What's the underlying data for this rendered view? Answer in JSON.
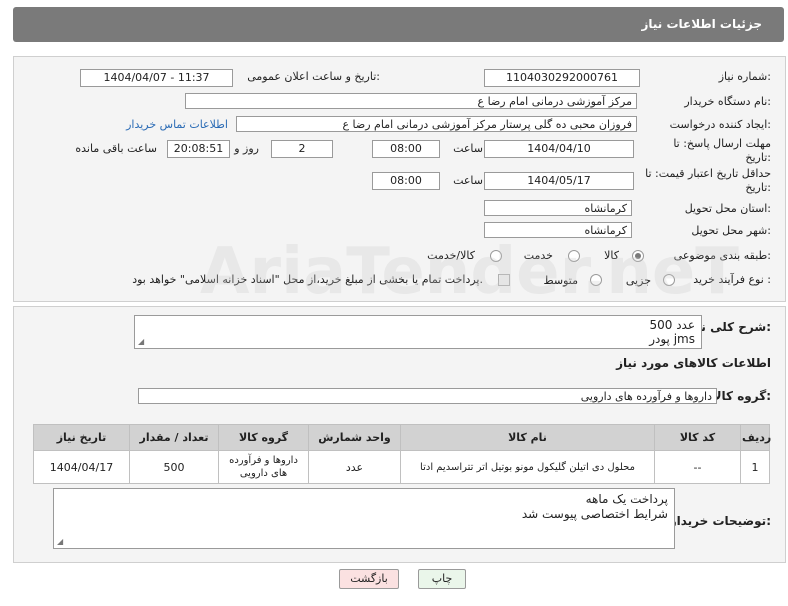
{
  "header": {
    "title": "جزئیات اطلاعات نیاز"
  },
  "form": {
    "need_number": {
      "label": "شماره نیاز:",
      "value": "1104030292000761"
    },
    "announce_datetime": {
      "label": "تاریخ و ساعت اعلان عمومی:",
      "value": "1404/04/07 - 11:37"
    },
    "buyer_org": {
      "label": "نام دستگاه خریدار:",
      "value": "مرکز آموزشی  درمانی امام رضا  ع"
    },
    "requester": {
      "label": "ایجاد کننده درخواست:",
      "value": "فروزان محبی ده گلی پرستار مرکز آموزشی  درمانی امام رضا  ع",
      "contact_link": "اطلاعات تماس خریدار"
    },
    "reply_deadline": {
      "label": "مهلت ارسال پاسخ: تا تاریخ:",
      "date": "1404/04/10",
      "time_label": "ساعت",
      "time": "08:00",
      "days": "2",
      "days_label": "روز و",
      "remaining": "20:08:51",
      "remaining_label": "ساعت باقی مانده"
    },
    "price_validity": {
      "label": "حداقل تاریخ اعتبار قیمت: تا تاریخ:",
      "date": "1404/05/17",
      "time_label": "ساعت",
      "time": "08:00"
    },
    "province": {
      "label": "استان محل تحویل:",
      "value": "کرمانشاه"
    },
    "city": {
      "label": "شهر محل تحویل:",
      "value": "کرمانشاه"
    },
    "category": {
      "label": "طبقه بندی موضوعی:",
      "options": [
        "کالا",
        "خدمت",
        "کالا/خدمت"
      ],
      "selected": "کالا"
    },
    "process_type": {
      "label": "نوع فرآیند خرید :",
      "options": [
        "جزیی",
        "متوسط"
      ],
      "note": "پرداخت تمام یا بخشی از مبلغ خرید،از محل \"اسناد خزانه اسلامی\" خواهد بود."
    }
  },
  "description": {
    "label": "شرح کلی نیاز:",
    "lines": [
      "500 عدد",
      "پودر  jms"
    ]
  },
  "goods_section": {
    "title": "اطلاعات کالاهای مورد نیاز",
    "group_label": "گروه کالا:",
    "group_value": "داروها و فرآورده های دارویی"
  },
  "table": {
    "headers": [
      "ردیف",
      "کد کالا",
      "نام کالا",
      "واحد شمارش",
      "تعداد / مقدار",
      "گروه کالا",
      "تاریخ نیاز"
    ],
    "rows": [
      [
        "1",
        "--",
        "محلول دی اتیلن گلیکول مونو بوتیل اتر تتراسدیم ادتا",
        "عدد",
        "500",
        "داروها و فرآورده های دارویی",
        "1404/04/17"
      ]
    ]
  },
  "buyer_notes": {
    "label": "توضیحات خریدار:",
    "lines": [
      "پرداخت یک ماهه",
      "شرایط اختصاصی پیوست شد"
    ]
  },
  "buttons": {
    "print": "چاپ",
    "back": "بازگشت"
  },
  "watermark": "AriaTender.neT",
  "colors": {
    "header_bg": "#7a7a7a",
    "table_header_bg": "#d2d2d2",
    "print_btn": "#eaf6ea",
    "back_btn": "#fbe1e1",
    "link": "#2a6bb5"
  }
}
